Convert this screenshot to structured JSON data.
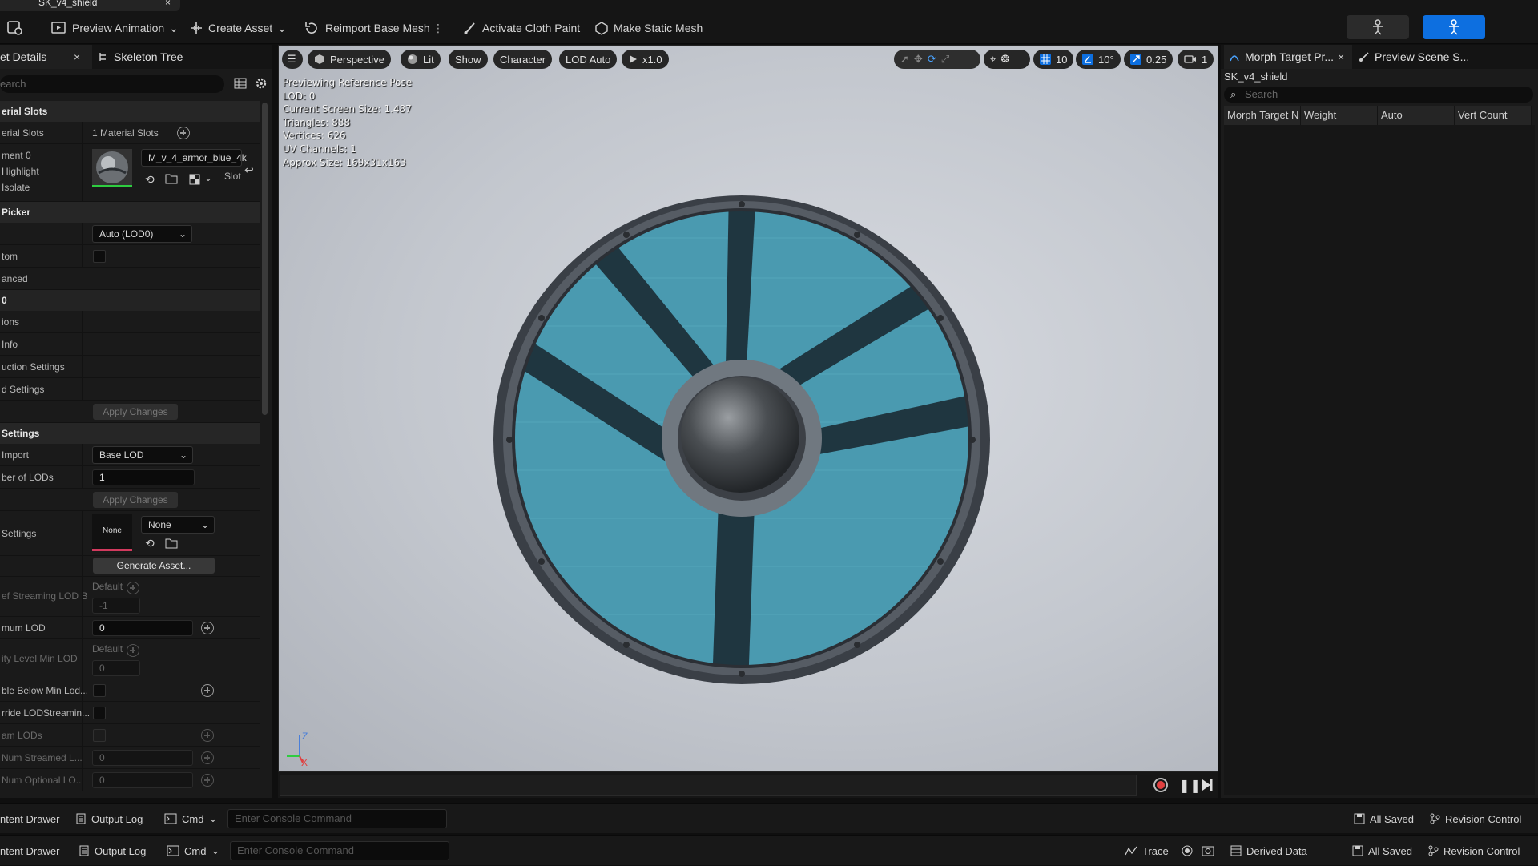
{
  "titlebar": {
    "tab_title": "SK_v4_shield"
  },
  "toolbar": {
    "preview_animation": "Preview Animation",
    "create_asset": "Create Asset",
    "reimport": "Reimport Base Mesh",
    "cloth_paint": "Activate Cloth Paint",
    "static_mesh": "Make Static Mesh"
  },
  "left_panel": {
    "tab_details": "et Details",
    "tab_skeleton": "Skeleton Tree",
    "search_placeholder": "earch",
    "sections": {
      "material_slots": "erial Slots",
      "lod_picker": " Picker",
      "lod_settings": " Settings"
    },
    "rows": {
      "material_slots_label": "erial Slots",
      "material_slots_value": "1 Material Slots",
      "element0": "ment 0",
      "highlight": " Highlight",
      "isolate": " Isolate",
      "material_name": "M_v_4_armor_blue_4k",
      "slot": "Slot",
      "lod_dropdown": "Auto (LOD0)",
      "custom": "tom",
      "advanced": "anced",
      "lod0": " 0",
      "sections": "ions",
      "info": " Info",
      "reduction": "uction Settings",
      "build": "d Settings",
      "apply1": "Apply Changes",
      "import": " Import",
      "import_value": "Base LOD",
      "num_lods": "ber of LODs",
      "num_lods_value": "1",
      "apply2": "Apply Changes",
      "lod_settings_row": " Settings",
      "none_thumb": "None",
      "none_dd": "None",
      "generate": "Generate Asset...",
      "streaming": "ef Streaming LOD B",
      "default1": "Default",
      "streaming_value": "-1",
      "min_lod": "mum LOD",
      "min_lod_value": "0",
      "default2": "Default",
      "quality_min": "ity Level Min LOD",
      "quality_value": "0",
      "disable_below": "ble Below Min Lod...",
      "override_stream": "rride LODStreamin...",
      "stream_lods": "am LODs",
      "num_streamed": " Num Streamed L...",
      "num_streamed_value": "0",
      "num_optional": " Num Optional LO...",
      "num_optional_value": "0"
    }
  },
  "viewport": {
    "perspective": "Perspective",
    "lit": "Lit",
    "show": "Show",
    "character": "Character",
    "lod": "LOD Auto",
    "speed": "x1.0",
    "grid_snap": "10",
    "rot_snap": "10°",
    "scale_snap": "0.25",
    "cam_speed": "1",
    "stats": [
      "Previewing Reference Pose",
      "LOD: 0",
      "Current Screen Size: 1.487",
      "Triangles: 888",
      "Vertices: 626",
      "UV Channels: 1",
      "Approx Size: 169x31x163"
    ],
    "axis_z": "Z",
    "axis_x": "X"
  },
  "right_panel": {
    "tab_morph": "Morph Target Pr...",
    "tab_scene": "Preview Scene S...",
    "asset_name": "SK_v4_shield",
    "search_placeholder": "Search",
    "columns": [
      "Morph Target N",
      "Weight",
      "Auto",
      "Vert Count"
    ]
  },
  "bottom_bar1": {
    "content_drawer": "ntent Drawer",
    "output_log": "Output Log",
    "cmd": "Cmd",
    "console_placeholder": "Enter Console Command",
    "all_saved": "All Saved",
    "revision": "Revision Control"
  },
  "bottom_bar2": {
    "content_drawer": "ntent Drawer",
    "output_log": "Output Log",
    "cmd": "Cmd",
    "console_placeholder": "Enter Console Command",
    "trace": "Trace",
    "derived": "Derived Data",
    "all_saved": "All Saved",
    "revision": "Revision Control"
  },
  "colors": {
    "accent_blue": "#0d6fe0",
    "shield_teal": "#4a9ab0",
    "shield_stripe": "#1f3640"
  }
}
